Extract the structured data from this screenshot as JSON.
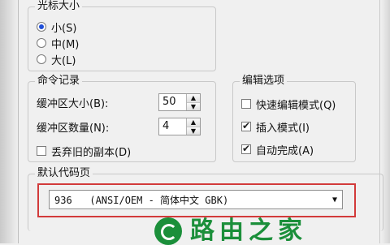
{
  "cursor_size": {
    "title": "光标大小",
    "options": [
      {
        "label": "小(S)",
        "selected": true
      },
      {
        "label": "中(M)",
        "selected": false
      },
      {
        "label": "大(L)",
        "selected": false
      }
    ]
  },
  "command_history": {
    "title": "命令记录",
    "buffer_size_label": "缓冲区大小(B):",
    "buffer_size_value": "50",
    "buffer_count_label": "缓冲区数量(N):",
    "buffer_count_value": "4",
    "discard_dup_label": "丢弃旧的副本(D)",
    "discard_dup_checked": false
  },
  "edit_options": {
    "title": "编辑选项",
    "items": [
      {
        "label": "快速编辑模式(Q)",
        "checked": false
      },
      {
        "label": "插入模式(I)",
        "checked": true
      },
      {
        "label": "自动完成(A)",
        "checked": true
      }
    ]
  },
  "default_codepage": {
    "title": "默认代码页",
    "value": "936   (ANSI/OEM - 简体中文 GBK)"
  },
  "watermark": {
    "text": "路由之家"
  }
}
